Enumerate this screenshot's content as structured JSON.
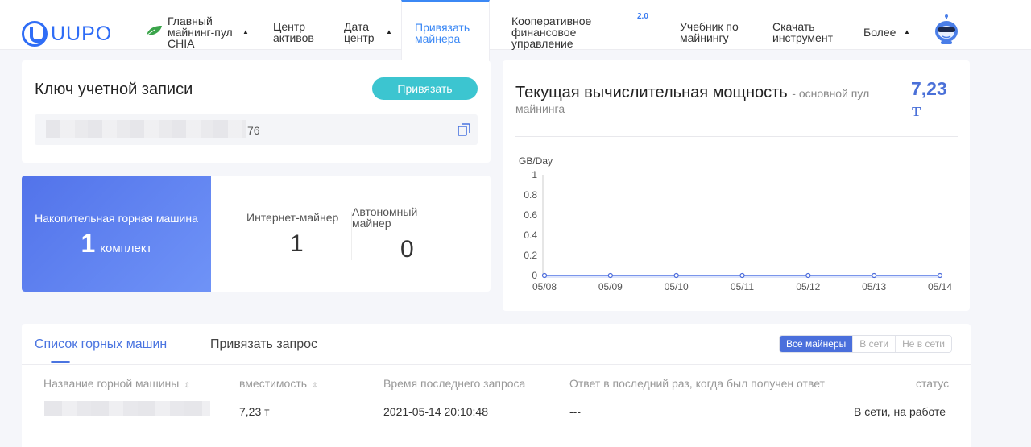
{
  "brand": {
    "name": "UUPO"
  },
  "nav": {
    "items": [
      {
        "label": "Главный майнинг-пул CHIA"
      },
      {
        "label": "Центр активов"
      },
      {
        "label": "Дата центр"
      },
      {
        "label": "Привязать майнера"
      },
      {
        "label": "Кооперативное финансовое управление",
        "badge": "2.0"
      },
      {
        "label": "Учебник по майнингу"
      },
      {
        "label": "Скачать инструмент"
      },
      {
        "label": "Более"
      }
    ]
  },
  "account": {
    "title": "Ключ учетной записи",
    "bind_label": "Привязать",
    "key_suffix": "76"
  },
  "stats": {
    "total_label": "Накопительная горная машина",
    "total_value": "1",
    "total_unit": "комплект",
    "online_label": "Интернет-майнер",
    "online_value": "1",
    "offline_label": "Автономный майнер",
    "offline_value": "0"
  },
  "power": {
    "title": "Текущая вычислительная мощность",
    "subtitle": "- основной пул майнинга",
    "value": "7,23",
    "unit": "T"
  },
  "chart_data": {
    "type": "line",
    "ylabel": "GB/Day",
    "x": [
      "05/08",
      "05/09",
      "05/10",
      "05/11",
      "05/12",
      "05/13",
      "05/14"
    ],
    "series": [
      {
        "values": [
          0,
          0,
          0,
          0,
          0,
          0,
          0
        ]
      }
    ],
    "yticks": [
      "0",
      "0.2",
      "0.4",
      "0.6",
      "0.8",
      "1"
    ],
    "ylim": [
      0,
      1
    ]
  },
  "list": {
    "tabs": [
      "Список горных машин",
      "Привязать запрос"
    ],
    "filters": [
      "Все майнеры",
      "В сети",
      "Не в сети"
    ],
    "columns": [
      "Название горной машины",
      "вместимость",
      "Время последнего запроса",
      "Ответ в последний раз, когда был получен ответ",
      "статус"
    ],
    "rows": [
      {
        "capacity": "7,23 т",
        "last_request": "2021-05-14 20:10:48",
        "last_response": "---",
        "status": "В сети, на работе"
      }
    ]
  },
  "colors": {
    "accent": "#3b88f5",
    "brand": "#2f6df6",
    "bind_button": "#3cc5d0",
    "stat_blue": "#5b7ff0"
  }
}
